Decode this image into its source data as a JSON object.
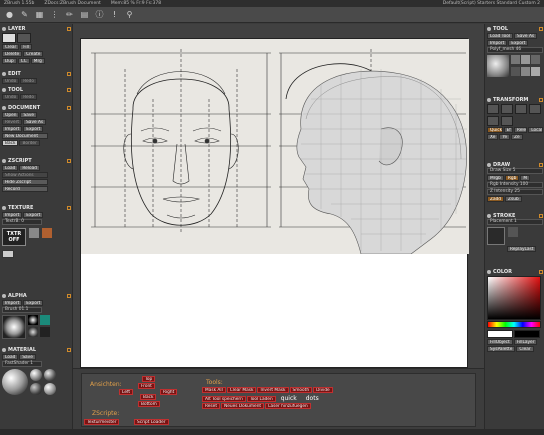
{
  "titlebar": {
    "app": "ZBrush 1.55b",
    "document": "ZDocs:ZBrush Document",
    "memory": "Mem:85 % Fr:9 Fs:378",
    "right": "Default(Script) Starters Standard Custom 2"
  },
  "toolbar_icons": [
    "bulb-icon",
    "brush-icon",
    "grid-icon",
    "dots-icon",
    "pen-icon",
    "book-icon",
    "info-icon",
    "exclaim-icon",
    "search-icon"
  ],
  "left": {
    "layer": {
      "title": "LAYER",
      "buttons": [
        [
          "Clear",
          "Fill"
        ],
        [
          "Delete",
          "Create"
        ],
        [
          "Dup",
          "CC",
          "Mrg"
        ]
      ]
    },
    "edit": {
      "title": "EDIT",
      "buttons": [
        "Undo",
        "Redo"
      ]
    },
    "tool": {
      "title": "TOOL",
      "buttons": [
        "Undo",
        "Redo"
      ]
    },
    "document": {
      "title": "DOCUMENT",
      "buttons": [
        [
          "Open",
          "Save"
        ],
        [
          "Revert",
          "Save As"
        ],
        [
          "Import",
          "Export"
        ]
      ],
      "new": "New Document",
      "back": "Back",
      "border": "Border"
    },
    "zscript": {
      "title": "ZSCRIPT",
      "buttons": [
        [
          "Load",
          "Reload"
        ]
      ],
      "show_actions": "Show Actions",
      "hide": "Hide Zscript",
      "record": "Record"
    },
    "texture": {
      "title": "TEXTURE",
      "buttons": [
        "Import",
        "Export"
      ],
      "slider": "TextrB: 0",
      "txtr": "TXTR",
      "off": "OFF"
    },
    "alpha": {
      "title": "ALPHA",
      "buttons": [
        "Import",
        "Export"
      ],
      "slider": "Brush 01.1"
    },
    "material": {
      "title": "MATERIAL",
      "buttons": [
        "Load",
        "Save"
      ],
      "slider": "FastShader 1"
    }
  },
  "right": {
    "tool": {
      "title": "TOOL",
      "buttons": [
        [
          "Load Tool",
          "Save As"
        ],
        [
          "Import",
          "Export"
        ]
      ],
      "slider": "Polyf_mesh 46"
    },
    "transform": {
      "title": "TRANSFORM",
      "buttons": [
        "Quick",
        "Ef",
        "Rele",
        "Local"
      ],
      "xyz": [
        "Xe",
        "Ye",
        "Ze"
      ]
    },
    "draw": {
      "title": "DRAW",
      "slider": "Draw Size 5",
      "rgb": "Rgb",
      "rgb_int": "Rgb Intensity 100",
      "z": "Z Intensity 25",
      "zadd": "Zadd",
      "zsub": "Zsub"
    },
    "stroke": {
      "title": "STROKE",
      "slider": "Placement 1",
      "replay": "ReplayLast"
    },
    "color": {
      "title": "COLOR",
      "buttons": [
        [
          "FillObject",
          "FillLayer"
        ],
        [
          "SysPalette",
          "Clear"
        ]
      ]
    }
  },
  "bottom": {
    "ansichten": "Ansichten:",
    "tools": "Tools:",
    "zscripte": "ZScripte:",
    "view_buttons": [
      "Top",
      "Front",
      "Left",
      "Right",
      "Back",
      "Bottom"
    ],
    "tools_row1": [
      "Mask All",
      "Clear Mask",
      "Invert Mask",
      "Smooth",
      "Divide"
    ],
    "tools_row2": [
      "Alt Tool speichern",
      "Tool Laden",
      "quick",
      "dots"
    ],
    "tools_row3": [
      "Reset",
      "Neues Dokument",
      "Laser hinzufuegen"
    ],
    "scripts": [
      "Texturmeister",
      "Script Loader"
    ]
  },
  "colors": {
    "accent": "#d08a2a",
    "panel": "#3a3a3a",
    "button_red": "#7a1313"
  }
}
